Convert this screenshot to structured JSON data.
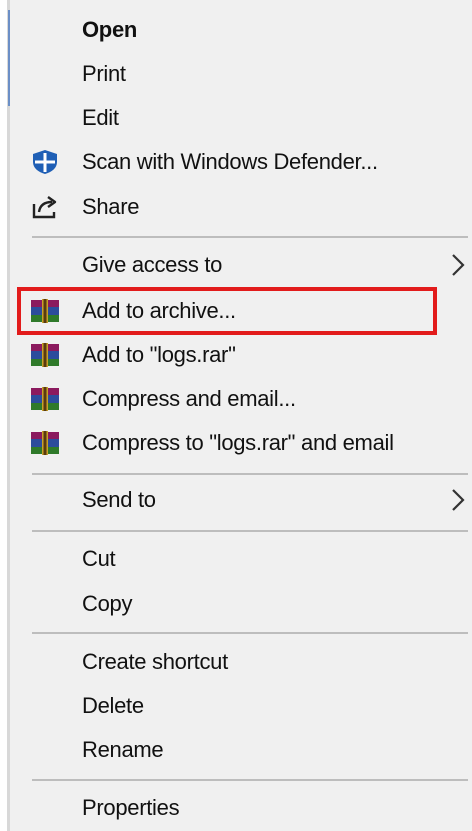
{
  "menu": {
    "items": [
      {
        "label": "Open",
        "bold": true
      },
      {
        "label": "Print"
      },
      {
        "label": "Edit"
      },
      {
        "label": "Scan with Windows Defender..."
      },
      {
        "label": "Share"
      },
      {
        "label": "Give access to"
      },
      {
        "label": "Add to archive..."
      },
      {
        "label": "Add to \"logs.rar\""
      },
      {
        "label": "Compress and email..."
      },
      {
        "label": "Compress to \"logs.rar\" and email"
      },
      {
        "label": "Send to"
      },
      {
        "label": "Cut"
      },
      {
        "label": "Copy"
      },
      {
        "label": "Create shortcut"
      },
      {
        "label": "Delete"
      },
      {
        "label": "Rename"
      },
      {
        "label": "Properties"
      }
    ]
  },
  "icons": {
    "defender": "windows-defender-shield-icon",
    "share": "share-icon",
    "winrar": "winrar-archive-icon",
    "submenu": "chevron-right-icon"
  },
  "colors": {
    "background": "#f0f0f0",
    "text": "#111111",
    "separator": "#bdbdbd",
    "highlight_box": "#e21b1b",
    "defender_blue": "#1f5fb5"
  }
}
